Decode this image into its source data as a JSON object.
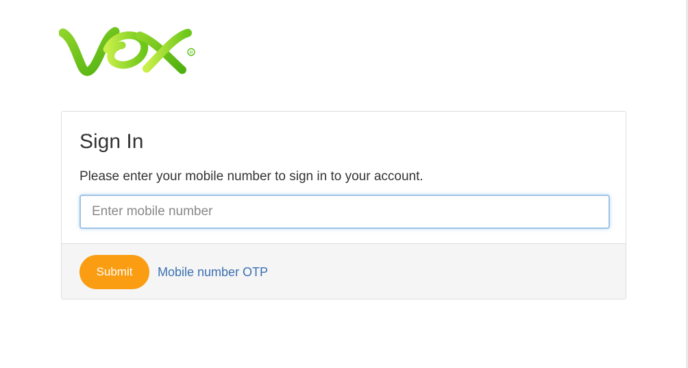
{
  "brand": {
    "name": "VOX",
    "logo_colors": [
      "#5bbf14",
      "#8fd42a",
      "#c5ec45"
    ]
  },
  "signin": {
    "title": "Sign In",
    "description": "Please enter your mobile number to sign in to your account.",
    "mobile_input": {
      "placeholder": "Enter mobile number",
      "value": ""
    },
    "submit_label": "Submit",
    "otp_link_label": "Mobile number OTP"
  },
  "colors": {
    "accent": "#fa9d12",
    "link": "#3a70b4",
    "focus_border": "#9fc2e4"
  }
}
